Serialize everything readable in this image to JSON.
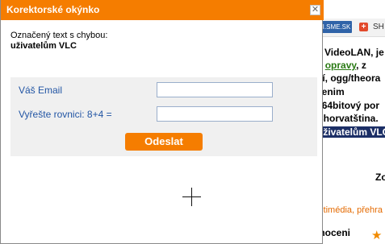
{
  "background": {
    "sme_badge": "I.SME.SK",
    "share_label": "SH",
    "lines": [
      "ý VideoLAN, je",
      "o",
      "opravy",
      ", z",
      "ní, ogg/theora",
      "čenim",
      "64bitový por",
      "Chorvatština.",
      "uživatelům VLC",
      "."
    ],
    "right_label_1": "Zo",
    "categories": "ultimédia,",
    "categories_link2": "přehra",
    "rating_label": "lnoceni"
  },
  "dialog": {
    "title": "Korektorské okýnko",
    "close_glyph": "✕",
    "marked_label": "Označený text s chybou:",
    "marked_text": "uživatelům VLC",
    "email_label": "Váš Email",
    "email_value": "",
    "equation_label": "Vyřešte rovnici: 8+4 =",
    "equation_value": "",
    "submit_label": "Odeslat"
  },
  "colors": {
    "accent": "#f57d00",
    "label_blue": "#2255a4",
    "panel_bg": "#f0f0f0"
  }
}
